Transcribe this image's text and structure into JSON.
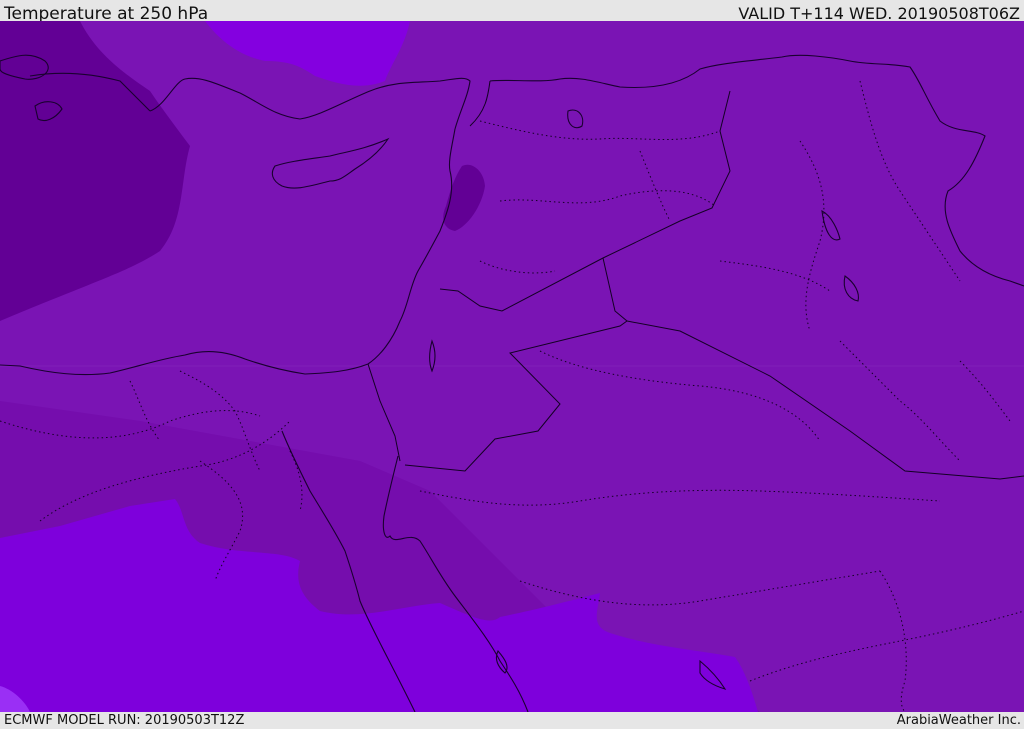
{
  "header": {
    "title": "Temperature at 250 hPa",
    "valid_time": "VALID T+114 WED. 20190508T06Z"
  },
  "footer": {
    "model_run": "ECMWF MODEL RUN: 20190503T12Z",
    "credit": "ArabiaWeather Inc."
  },
  "map": {
    "field": "temperature",
    "level": "250 hPa",
    "colors": {
      "base": "#7a14b4",
      "cold": "#620095",
      "colder_band": "#7209a9",
      "warm": "#7e00dc",
      "warmer": "#8f1cf0",
      "coast": "#1a0030",
      "border": "#140025"
    }
  }
}
